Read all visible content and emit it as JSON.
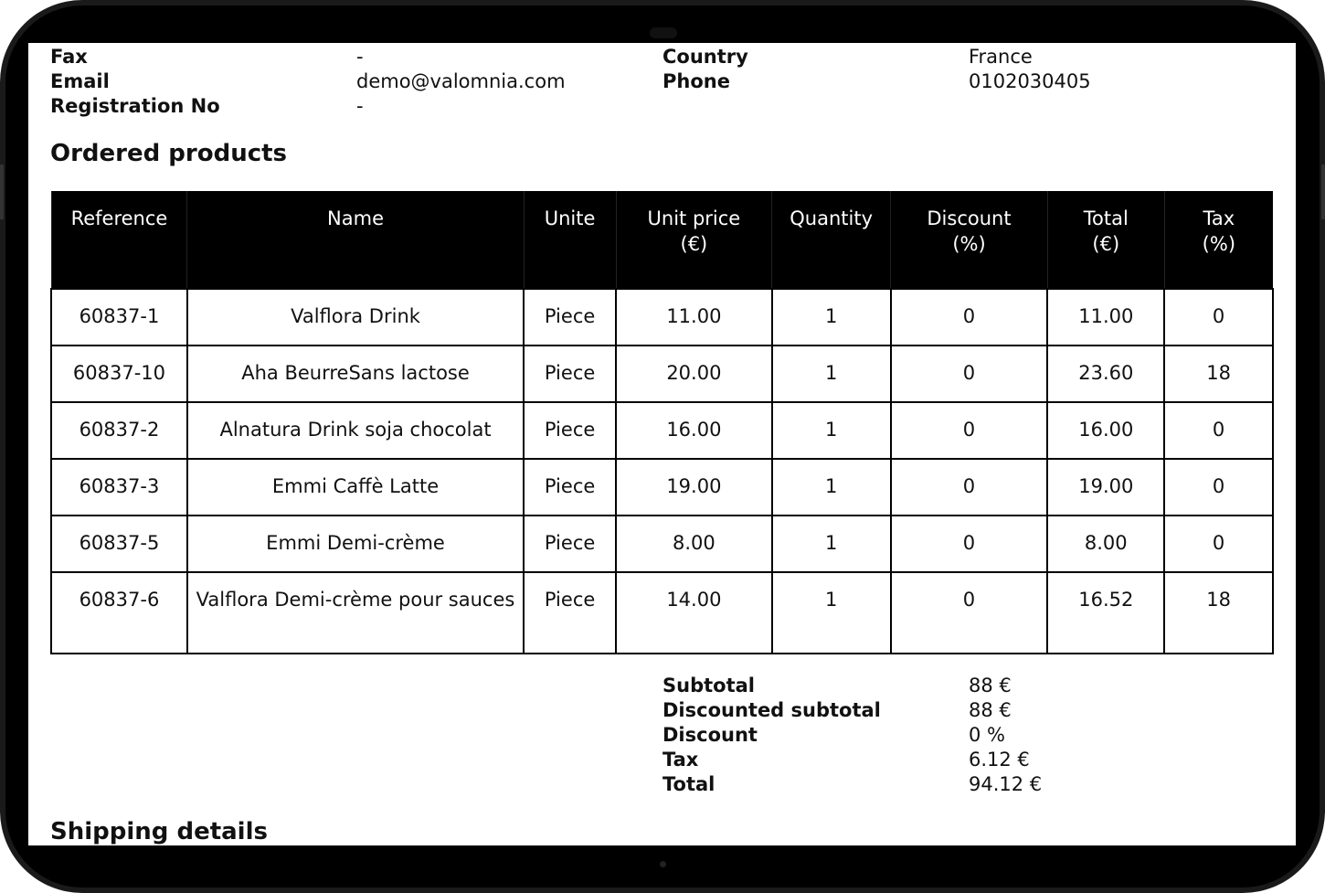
{
  "customer_info": {
    "rows": [
      {
        "label_left": "Fax",
        "value_left": "-",
        "label_right": "Country",
        "value_right": "France"
      },
      {
        "label_left": "Email",
        "value_left": "demo@valomnia.com",
        "label_right": "Phone",
        "value_right": "0102030405"
      },
      {
        "label_left": "Registration No",
        "value_left": "-",
        "label_right": "",
        "value_right": ""
      }
    ]
  },
  "ordered_products": {
    "title": "Ordered products",
    "headers": [
      "Reference",
      "Name",
      "Unite",
      "Unit price\n(€)",
      "Quantity",
      "Discount\n(%)",
      "Total\n(€)",
      "Tax\n(%)"
    ],
    "rows": [
      [
        "60837-1",
        "Valflora Drink",
        "Piece",
        "11.00",
        "1",
        "0",
        "11.00",
        "0"
      ],
      [
        "60837-10",
        "Aha BeurreSans lactose",
        "Piece",
        "20.00",
        "1",
        "0",
        "23.60",
        "18"
      ],
      [
        "60837-2",
        "Alnatura  Drink soja chocolat",
        "Piece",
        "16.00",
        "1",
        "0",
        "16.00",
        "0"
      ],
      [
        "60837-3",
        "Emmi Caffè Latte",
        "Piece",
        "19.00",
        "1",
        "0",
        "19.00",
        "0"
      ],
      [
        "60837-5",
        "Emmi Demi-crème",
        "Piece",
        "8.00",
        "1",
        "0",
        "8.00",
        "0"
      ],
      [
        "60837-6",
        "Valflora Demi-crème pour sauces",
        "Piece",
        "14.00",
        "1",
        "0",
        "16.52",
        "18"
      ]
    ]
  },
  "summary": [
    {
      "label": "Subtotal",
      "value": "88 €"
    },
    {
      "label": "Discounted subtotal",
      "value": "88 €"
    },
    {
      "label": "Discount",
      "value": "0 %"
    },
    {
      "label": "Tax",
      "value": "6.12 €"
    },
    {
      "label": "Total",
      "value": "94.12 €"
    }
  ],
  "shipping": {
    "title": "Shipping details"
  }
}
